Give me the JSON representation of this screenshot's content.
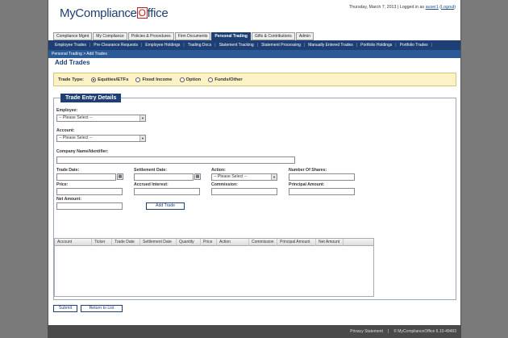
{
  "header": {
    "logo_text_a": "MyCompliance",
    "logo_text_o": "O",
    "logo_text_b": "ffice",
    "date": "Thursday, March 7, 2013",
    "logged_in_as": "Logged in as",
    "username": "auser1",
    "logout": "Logout"
  },
  "tabs": [
    {
      "label": "Compliance Mgmt"
    },
    {
      "label": "My Compliance"
    },
    {
      "label": "Policies & Procedures"
    },
    {
      "label": "Firm Documents"
    },
    {
      "label": "Personal Trading"
    },
    {
      "label": "Gifts & Contributions"
    },
    {
      "label": "Admin"
    }
  ],
  "subnav": [
    {
      "label": "Employee Trades"
    },
    {
      "label": "Pre-Clearance Requests"
    },
    {
      "label": "Employee Holdings"
    },
    {
      "label": "Trading Docs"
    },
    {
      "label": "Statement Tracking"
    },
    {
      "label": "Statement Processing"
    },
    {
      "label": "Manually Entered Trades"
    },
    {
      "label": "Portfolio Holdings"
    },
    {
      "label": "Portfolio Trades"
    }
  ],
  "breadcrumb": {
    "parent": "Personal Trading",
    "sep": ">",
    "current": "Add Trades"
  },
  "page_title": "Add Trades",
  "trade_type": {
    "label": "Trade Type:",
    "options": [
      {
        "label": "Equities/ETFs",
        "selected": true
      },
      {
        "label": "Fixed Income",
        "selected": false
      },
      {
        "label": "Option",
        "selected": false
      },
      {
        "label": "Funds/Other",
        "selected": false
      }
    ]
  },
  "form": {
    "legend": "Trade Entry Details",
    "employee_label": "Employee:",
    "employee_value": "-- Please Select --",
    "account_label": "Account:",
    "account_value": "-- Please Select --",
    "company_label": "Company Name/Identifier:",
    "trade_date_label": "Trade Date:",
    "settlement_date_label": "Settlement Date:",
    "action_label": "Action:",
    "action_value": "-- Please Select --",
    "shares_label": "Number Of Shares:",
    "price_label": "Price:",
    "accrued_label": "Accrued Interest:",
    "commission_label": "Commission:",
    "principal_label": "Principal Amount:",
    "net_label": "Net Amount:",
    "add_trade": "Add Trade"
  },
  "grid": {
    "columns": [
      "Account",
      "Ticker",
      "Trade Date",
      "Settlement Date",
      "Quantity",
      "Price",
      "Action",
      "Commission",
      "Principal Amount",
      "Net Amount"
    ]
  },
  "buttons": {
    "submit": "Submit",
    "return": "Return to List"
  },
  "footer": {
    "privacy": "Privacy Statement",
    "sep": "|",
    "copyright": "© MyComplianceOffice 6.10-49493"
  },
  "colors": {
    "brand_navy": "#1d3f73",
    "brand_red": "#c41e1e",
    "trade_type_bg": "#fbf2c6"
  }
}
